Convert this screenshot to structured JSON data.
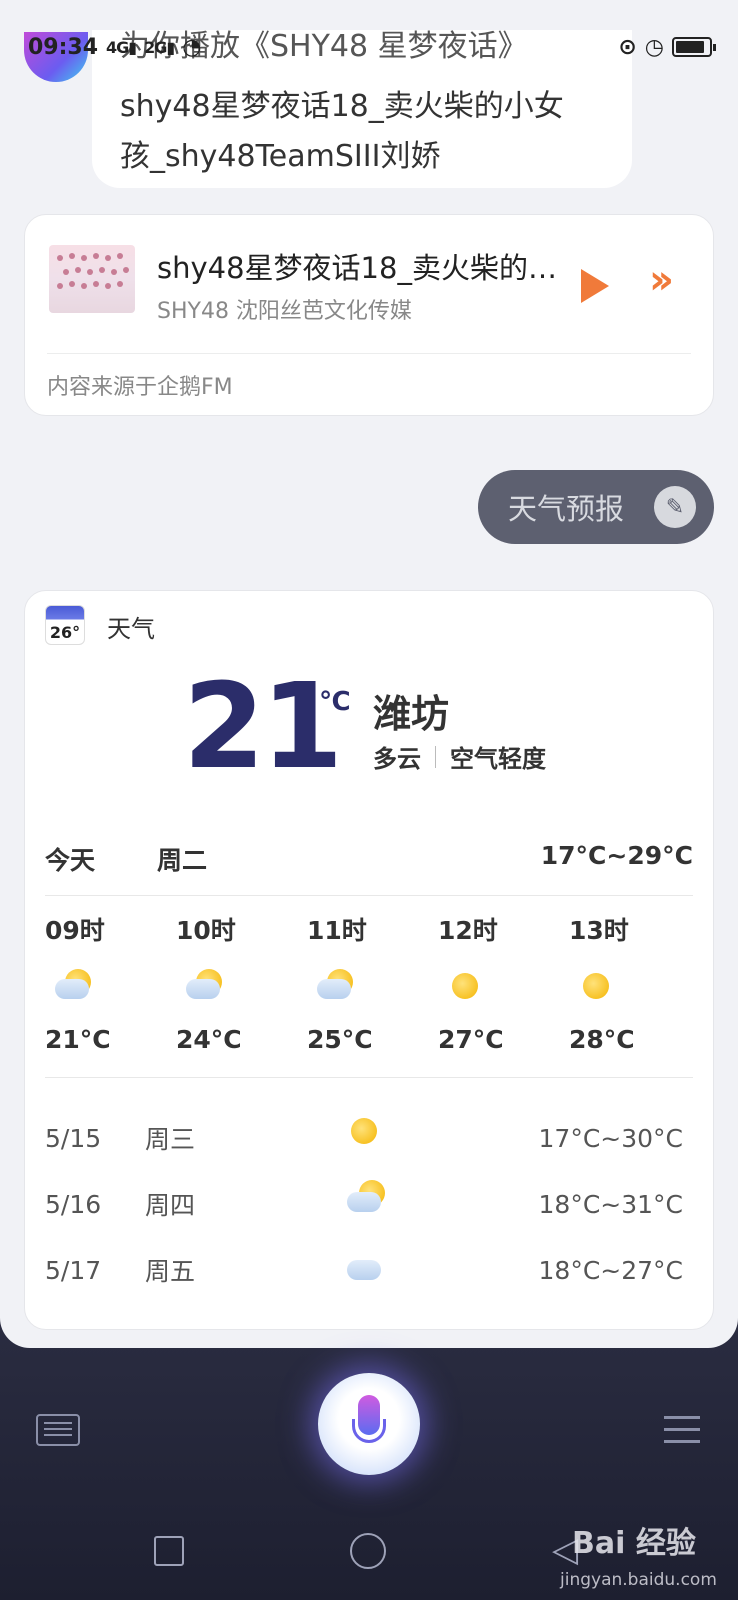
{
  "status_bar": {
    "time": "09:34",
    "signal1": "4G",
    "signal2": "2G"
  },
  "assistant": {
    "partial_line": "为你播放《SHY48 星梦夜话》",
    "message_line1": "shy48星梦夜话18_卖火柴的小女",
    "message_line2": "孩_shy48TeamSIII刘娇"
  },
  "music_card": {
    "title": "shy48星梦夜话18_卖火柴的小女孩_shy48TeamSIII刘娇",
    "subtitle": "SHY48 沈阳丝芭文化传媒",
    "source": "内容来源于企鹅FM",
    "play_icon": "play-icon",
    "next_icon": "double-chevron-right-icon",
    "accent_color": "#f07a3a"
  },
  "user_query": {
    "text": "天气预报",
    "edit_icon": "edit-icon"
  },
  "weather": {
    "app_name": "天气",
    "app_icon_number": "26°",
    "temperature": "21",
    "unit": "℃",
    "city": "潍坊",
    "condition": "多云",
    "air_quality": "空气轻度",
    "today": {
      "label": "今天",
      "weekday": "周二",
      "range": "17°C~29°C"
    },
    "hourly": [
      {
        "time": "09时",
        "icon": "partly-cloudy-icon",
        "temp": "21°C"
      },
      {
        "time": "10时",
        "icon": "partly-cloudy-icon",
        "temp": "24°C"
      },
      {
        "time": "11时",
        "icon": "partly-cloudy-icon",
        "temp": "25°C"
      },
      {
        "time": "12时",
        "icon": "sunny-icon",
        "temp": "27°C"
      },
      {
        "time": "13时",
        "icon": "sunny-icon",
        "temp": "28°C"
      }
    ],
    "daily": [
      {
        "date": "5/15",
        "weekday": "周三",
        "icon": "sunny-icon",
        "range": "17°C~30°C"
      },
      {
        "date": "5/16",
        "weekday": "周四",
        "icon": "partly-cloudy-icon",
        "range": "18°C~31°C"
      },
      {
        "date": "5/17",
        "weekday": "周五",
        "icon": "cloudy-icon",
        "range": "18°C~27°C"
      }
    ],
    "temp_color": "#2b2d6a"
  },
  "bottom_bar": {
    "keyboard_icon": "keyboard-icon",
    "mic_icon": "microphone-icon",
    "menu_icon": "menu-icon"
  },
  "watermark": {
    "brand": "Bai 经验",
    "url": "jingyan.baidu.com"
  }
}
